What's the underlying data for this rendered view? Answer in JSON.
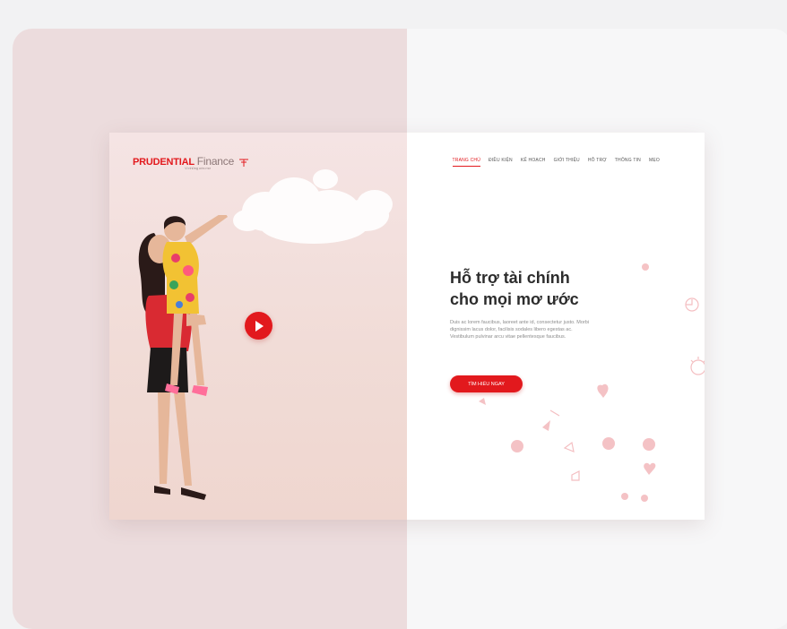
{
  "logo": {
    "brand": "PRUDENTIAL",
    "suffix": "Finance",
    "tagline": "Vì những ước mơ"
  },
  "nav": {
    "items": [
      {
        "label": "TRANG CHỦ",
        "active": true
      },
      {
        "label": "ĐIỀU KIỆN",
        "active": false
      },
      {
        "label": "KẾ HOẠCH",
        "active": false
      },
      {
        "label": "GIỚI THIỆU",
        "active": false
      },
      {
        "label": "HỖ TRỢ",
        "active": false
      },
      {
        "label": "THÔNG TIN",
        "active": false
      },
      {
        "label": "MẸO",
        "active": false
      }
    ]
  },
  "hero": {
    "title_line1": "Hỗ trợ tài chính",
    "title_line2": "cho mọi mơ ước",
    "description": "Duis ac lorem faucibus, laoreet ante id, consectetur justo. Morbi dignissim lacus dolor, facilisis sodales libero egestas ac. Vestibulum pulvinar arcu vitae pellentesque faucibus.",
    "cta_label": "TÌM HIỂU NGAY"
  },
  "icons": {
    "play": "play-icon",
    "cloud": "cloud-illustration",
    "people": "mother-daughter-photo"
  },
  "colors": {
    "accent": "#e2191d",
    "panel_left": "#ecdcdd",
    "hero_bg": "#f3e0dd"
  }
}
